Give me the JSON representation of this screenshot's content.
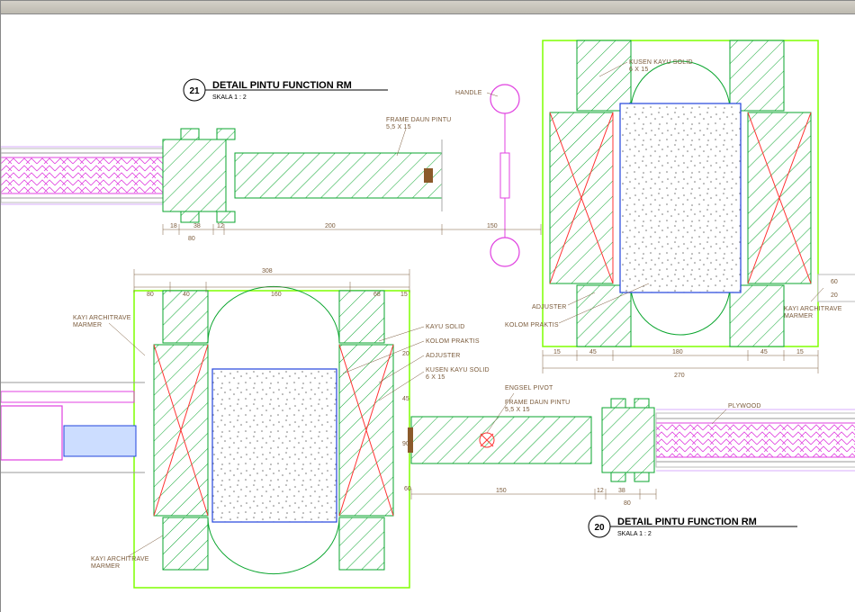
{
  "detail21": {
    "bubble": "21",
    "title": "DETAIL PINTU FUNCTION RM",
    "scale": "SKALA  1 : 2",
    "labels": {
      "handle": "HANDLE",
      "frame_daun": "FRAME DAUN PINTU\n5,5 X 15",
      "kusen": "KUSEN KAYU SOLID\n6 X 15",
      "adjuster": "ADJUSTER",
      "kolom": "KOLOM PRAKTIS",
      "archi": "KAYI ARCHITRAVE\nMARMER"
    },
    "dims": {
      "d18": "18",
      "d38": "38",
      "d12": "12",
      "d80": "80",
      "d200": "200",
      "d150": "150",
      "d45": "45",
      "d15": "15",
      "d270": "270",
      "d180": "180",
      "d20": "20",
      "d60": "60"
    }
  },
  "detail20": {
    "bubble": "20",
    "title": "DETAIL PINTU FUNCTION RM",
    "scale": "SKALA  1 : 2",
    "labels": {
      "archi": "KAYI ARCHITRAVE\nMARMER",
      "kayu": "KAYU SOLID",
      "kolom": "KOLOM PRAKTIS",
      "adjuster": "ADJUSTER",
      "kusen": "KUSEN KAYU SOLID\n6 X 15",
      "engsel": "ENGSEL PIVOT",
      "frame_daun": "FRAME DAUN PINTU\n5,5 X 15",
      "plywood": "PLYWOOD"
    },
    "dims": {
      "d308": "308",
      "d80": "80",
      "d40": "40",
      "d160": "160",
      "d68": "68",
      "d15": "15",
      "d45": "45",
      "d150": "150",
      "d12": "12",
      "d38": "38",
      "d20": "20",
      "d60": "60",
      "d90": "90"
    }
  }
}
